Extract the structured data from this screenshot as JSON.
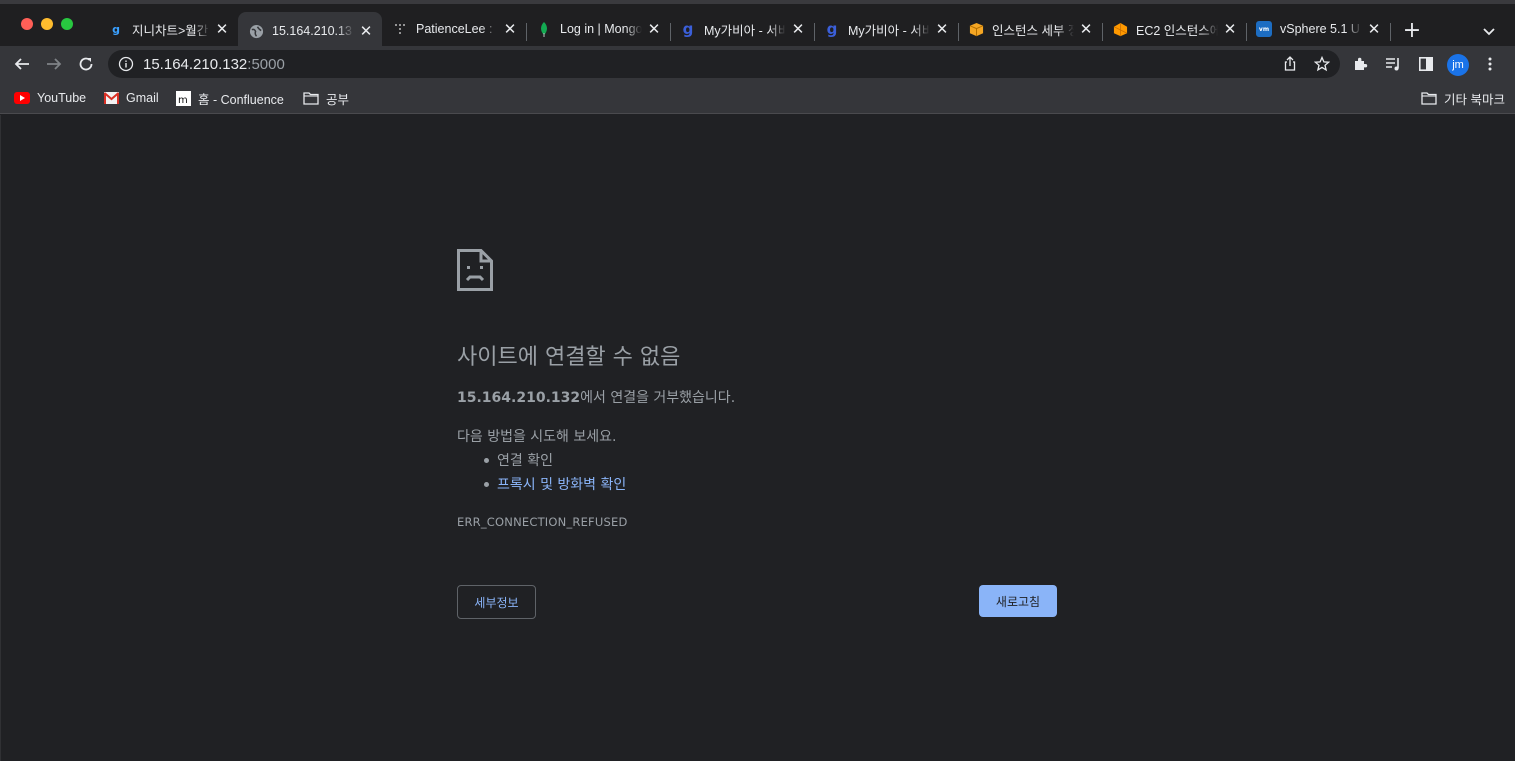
{
  "tabs": [
    {
      "title": "지니차트>월간 - ",
      "favicon": "genie-icon",
      "active": false
    },
    {
      "title": "15.164.210.13",
      "favicon": "globe-icon",
      "active": true
    },
    {
      "title": "PatienceLee :",
      "favicon": "dots-icon",
      "active": false
    },
    {
      "title": "Log in | Mongo",
      "favicon": "mongodb-leaf-icon",
      "active": false
    },
    {
      "title": "My가비아 - 서비",
      "favicon": "gabia-icon",
      "active": false
    },
    {
      "title": "My가비아 - 서비",
      "favicon": "gabia-icon",
      "active": false
    },
    {
      "title": "인스턴스 세부 정",
      "favicon": "box-icon",
      "active": false
    },
    {
      "title": "EC2 인스턴스에",
      "favicon": "aws-cube-icon",
      "active": false
    },
    {
      "title": "vSphere 5.1 U",
      "favicon": "vmware-icon",
      "active": false
    }
  ],
  "address": {
    "host": "15.164.210.132",
    "port": ":5000"
  },
  "bookmarks": [
    {
      "label": "YouTube",
      "icon": "youtube-icon"
    },
    {
      "label": "Gmail",
      "icon": "gmail-icon"
    },
    {
      "label": "홈 - Confluence",
      "icon": "confluence-icon"
    },
    {
      "label": "공부",
      "icon": "folder-icon"
    }
  ],
  "other_bookmarks": "기타 북마크",
  "profile_initials": "jm",
  "error": {
    "title": "사이트에 연결할 수 없음",
    "host": "15.164.210.132",
    "summary_suffix": "에서 연결을 거부했습니다.",
    "try_title": "다음 방법을 시도해 보세요.",
    "suggestions": [
      "연결 확인",
      "프록시 및 방화벽 확인"
    ],
    "code": "ERR_CONNECTION_REFUSED",
    "details_label": "세부정보",
    "reload_label": "새로고침"
  },
  "colors": {
    "accent": "#8ab4f8",
    "background": "#202124",
    "toolbar": "#35363a"
  }
}
